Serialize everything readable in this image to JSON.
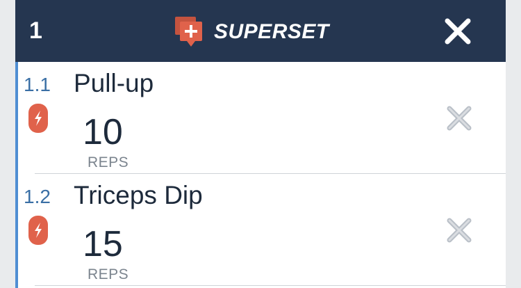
{
  "header": {
    "index": "1",
    "title": "SUPERSET",
    "icon": "superset-add-icon",
    "close_icon": "close-icon"
  },
  "exercises": [
    {
      "number": "1.1",
      "name": "Pull-up",
      "reps": "10",
      "reps_label": "REPS",
      "type_icon": "bolt-badge-icon",
      "remove_icon": "remove-icon"
    },
    {
      "number": "1.2",
      "name": "Triceps Dip",
      "reps": "15",
      "reps_label": "REPS",
      "type_icon": "bolt-badge-icon",
      "remove_icon": "remove-icon"
    }
  ],
  "colors": {
    "header_bg": "#253650",
    "accent_orange": "#e0624b",
    "accent_blue": "#4f8ed3",
    "text_dark": "#1d2a3b",
    "text_muted": "#7b848e"
  }
}
